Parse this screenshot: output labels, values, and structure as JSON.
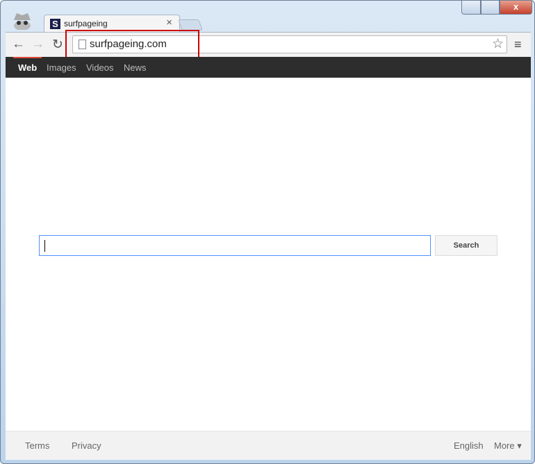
{
  "tab": {
    "title": "surfpageing",
    "favicon": "S"
  },
  "window": {
    "close": "x"
  },
  "omnibox": {
    "url": "surfpageing.com"
  },
  "gbar": {
    "items": [
      "Web",
      "Images",
      "Videos",
      "News"
    ],
    "active": "Web"
  },
  "search": {
    "value": "",
    "button": "Search"
  },
  "footer": {
    "terms": "Terms",
    "privacy": "Privacy",
    "language": "English",
    "more": "More ▾"
  },
  "colors": {
    "highlight": "#cc0000",
    "gbar": "#2d2d2d",
    "active_underline": "#dd4b39"
  }
}
